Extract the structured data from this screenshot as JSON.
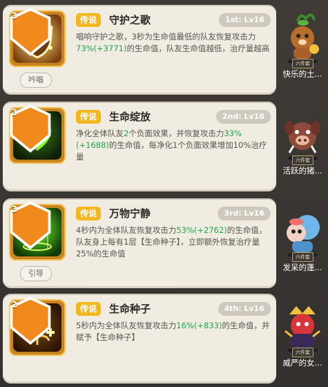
{
  "skills": [
    {
      "level": "3",
      "tag": "吟唱",
      "rarity": "传说",
      "name": "守护之歌",
      "rank": "1st: Lv16",
      "desc": [
        {
          "t": "唱响守护之歌，3秒为生命值最低的队友恢复攻击力"
        },
        {
          "t": "73%(+3771)",
          "g": true
        },
        {
          "t": "的生命值，队友生命值越低，治疗量越高"
        }
      ],
      "pet_badge": "六件套",
      "pet_name": "快乐的土..."
    },
    {
      "level": "3",
      "tag": "",
      "rarity": "传说",
      "name": "生命绽放",
      "rank": "2nd: Lv16",
      "desc": [
        {
          "t": "净化全体队友"
        },
        {
          "t": "2",
          "g": true
        },
        {
          "t": "个负面效果，并恢复攻击力"
        },
        {
          "t": "33%(+1688)",
          "g": true
        },
        {
          "t": "的生命值，每净化1个负面效果增加10%治疗量"
        }
      ],
      "pet_badge": "六件套",
      "pet_name": "活跃的猪..."
    },
    {
      "level": "3",
      "tag": "引导",
      "rarity": "传说",
      "name": "万物宁静",
      "rank": "3rd: Lv16",
      "desc": [
        {
          "t": "4秒内为全体队友恢复攻击力"
        },
        {
          "t": "53%(+2762)",
          "g": true
        },
        {
          "t": "的生命值，队友身上每有1层【生命种子】，立即额外恢复治疗量25%的生命值"
        }
      ],
      "pet_badge": "六件套",
      "pet_name": "发呆的蓬..."
    },
    {
      "level": "2",
      "tag": "",
      "rarity": "传说",
      "name": "生命种子",
      "rank": "4th: Lv16",
      "desc": [
        {
          "t": "5秒内为全体队友恢复攻击力"
        },
        {
          "t": "16%(+833)",
          "g": true
        },
        {
          "t": "的生命值，并赋予【生命种子】"
        }
      ],
      "pet_badge": "六件套",
      "pet_name": "威严的女..."
    }
  ],
  "colors": {
    "green_value": "#1fa44d",
    "rarity_bg": "#f4b81f",
    "card_bg": "#f1ece2"
  },
  "icons": [
    "shield-cross-icon",
    "heart-flower-icon",
    "glowing-heart-icon",
    "seed-sprout-icon"
  ]
}
